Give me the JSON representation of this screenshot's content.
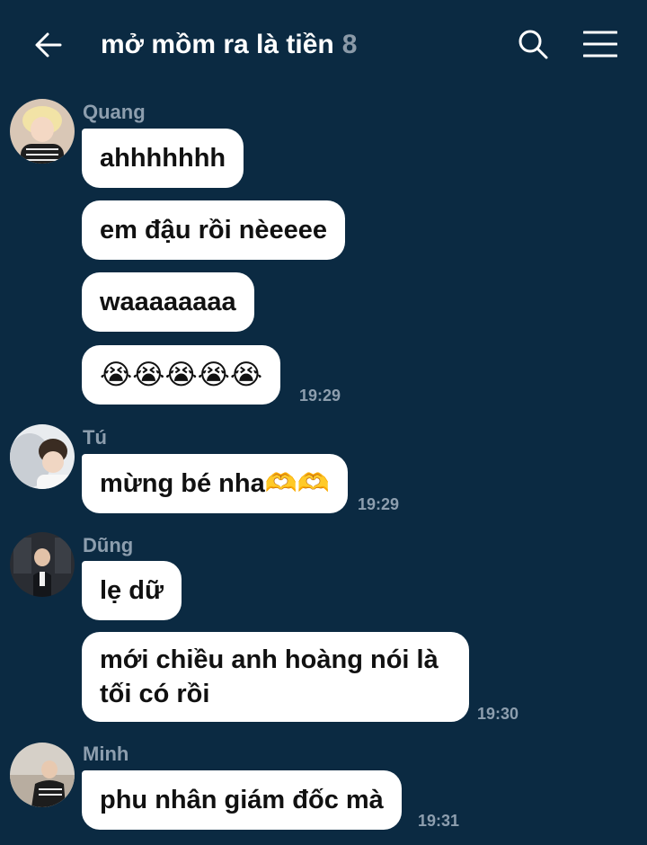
{
  "header": {
    "back_icon": "arrow-left-icon",
    "title": "mở mồm ra là tiền",
    "member_count": "8",
    "search_icon": "search-icon",
    "menu_icon": "hamburger-menu-icon"
  },
  "colors": {
    "background": "#0b2a42",
    "bubble": "#ffffff",
    "muted_text": "#8d9eae"
  },
  "messages": [
    {
      "sender": "Quang",
      "bubbles": [
        "ahhhhhhh",
        "em đậu rồi nèeeee",
        "waaaaaaaa",
        "😭😭😭😭😭"
      ],
      "time": "19:29"
    },
    {
      "sender": "Tú",
      "bubbles": [
        "mừng bé nha🫶🫶"
      ],
      "time": "19:29"
    },
    {
      "sender": "Dũng",
      "bubbles": [
        "lẹ dữ",
        "mới chiều anh hoàng nói là tối có rồi"
      ],
      "time": "19:30"
    },
    {
      "sender": "Minh",
      "bubbles": [
        "phu nhân giám đốc mà"
      ],
      "time": "19:31"
    }
  ]
}
